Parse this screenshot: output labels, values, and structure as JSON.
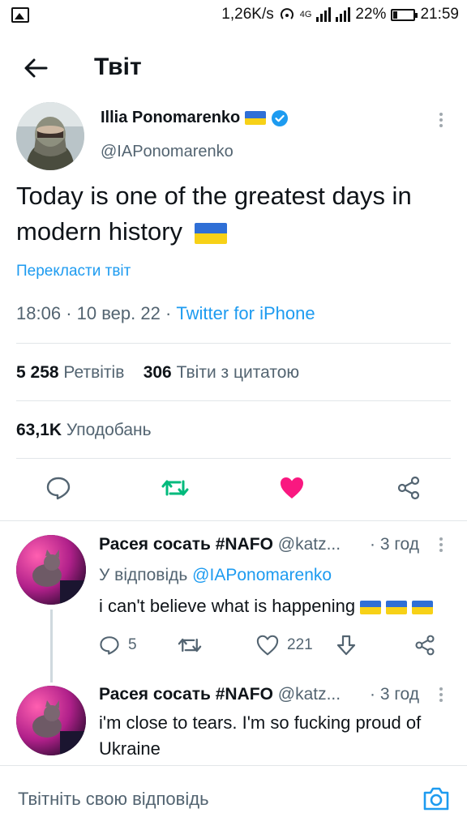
{
  "status_bar": {
    "speed": "1,26K/s",
    "network": "4G",
    "battery": "22%",
    "time": "21:59"
  },
  "header": {
    "title": "Твіт"
  },
  "tweet": {
    "author_name": "Illia Ponomarenko",
    "author_handle": "@IAPonomarenko",
    "text": "Today is one of the greatest days in modern history",
    "translate_label": "Перекласти твіт",
    "time": "18:06",
    "date": "10 вер. 22",
    "separator": "·",
    "source": "Twitter for iPhone",
    "retweets_count": "5 258",
    "retweets_label": "Ретвітів",
    "quotes_count": "306",
    "quotes_label": "Твіти з цитатою",
    "likes_count": "63,1K",
    "likes_label": "Уподобань"
  },
  "replies": [
    {
      "name": "Расея сосать #NAFO",
      "handle": "@katz...",
      "time": "3 год",
      "replying_prefix": "У відповідь",
      "replying_to": "@IAPonomarenko",
      "text": "i can't believe what is happening",
      "reply_count": "5",
      "like_count": "221"
    },
    {
      "name": "Расея сосать #NAFO",
      "handle": "@katz...",
      "time": "3 год",
      "text": "i'm close to tears. I'm so fucking proud of Ukraine"
    }
  ],
  "compose": {
    "placeholder": "Твітніть свою відповідь"
  },
  "colors": {
    "accent": "#1d9bf0",
    "retweet_active": "#00ba7c",
    "like_active": "#f91880",
    "secondary_text": "#536471"
  }
}
